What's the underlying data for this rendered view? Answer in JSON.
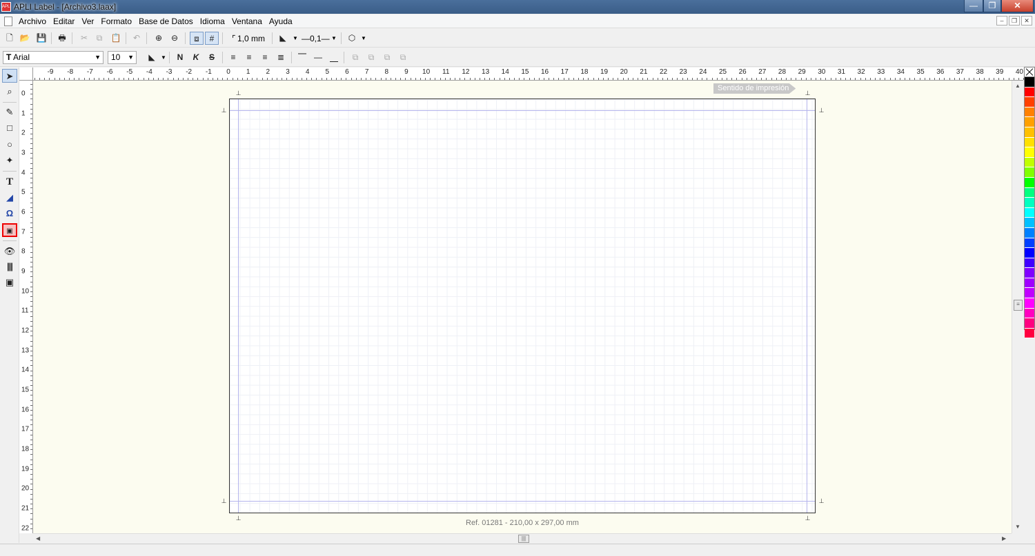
{
  "window": {
    "title": "APLI Label - [Archivo3.laax]",
    "app_icon_text": "APLI",
    "min": "—",
    "max": "❐",
    "close": "✕"
  },
  "menu": {
    "items": [
      "Archivo",
      "Editar",
      "Ver",
      "Formato",
      "Base de Datos",
      "Idioma",
      "Ventana",
      "Ayuda"
    ]
  },
  "toolbar1": {
    "grid_step": "1,0 mm",
    "line_width": "—0,1—"
  },
  "toolbar2": {
    "font": "Arial",
    "font_prefix": "T",
    "size": "10",
    "bold": "N",
    "italic": "K",
    "strike": "S"
  },
  "ruler": {
    "h_labels": [
      "-9",
      "-8",
      "-7",
      "-6",
      "-5",
      "-4",
      "-3",
      "-2",
      "-1",
      "0",
      "1",
      "2",
      "3",
      "4",
      "5",
      "6",
      "7",
      "8",
      "9",
      "10",
      "11",
      "12",
      "13",
      "14",
      "15",
      "16",
      "17",
      "18",
      "19",
      "20",
      "21",
      "22",
      "23",
      "24",
      "25",
      "26",
      "27",
      "28",
      "29",
      "30",
      "31",
      "32",
      "33",
      "34",
      "35",
      "36",
      "37",
      "38",
      "39",
      "40"
    ],
    "v_labels": [
      "0",
      "1",
      "2",
      "3",
      "4",
      "5",
      "6",
      "7",
      "8",
      "9",
      "10",
      "11",
      "12",
      "13",
      "14",
      "15",
      "16",
      "17",
      "18",
      "19",
      "20",
      "21",
      "22"
    ]
  },
  "canvas": {
    "print_direction": "Sentido de impresión",
    "ref": "Ref. 01281 - 210,00 x 297,00 mm"
  },
  "palette": [
    "#000000",
    "#ff0000",
    "#ff4000",
    "#ff8000",
    "#ffa000",
    "#ffc000",
    "#ffe000",
    "#ffff00",
    "#c0ff00",
    "#80ff00",
    "#00ff00",
    "#00ff80",
    "#00ffc0",
    "#00ffff",
    "#00c0ff",
    "#0080ff",
    "#0040ff",
    "#0000ff",
    "#4000ff",
    "#8000ff",
    "#a000ff",
    "#c000ff",
    "#ff00ff",
    "#ff00c0",
    "#ff0080",
    "#ff0040"
  ]
}
